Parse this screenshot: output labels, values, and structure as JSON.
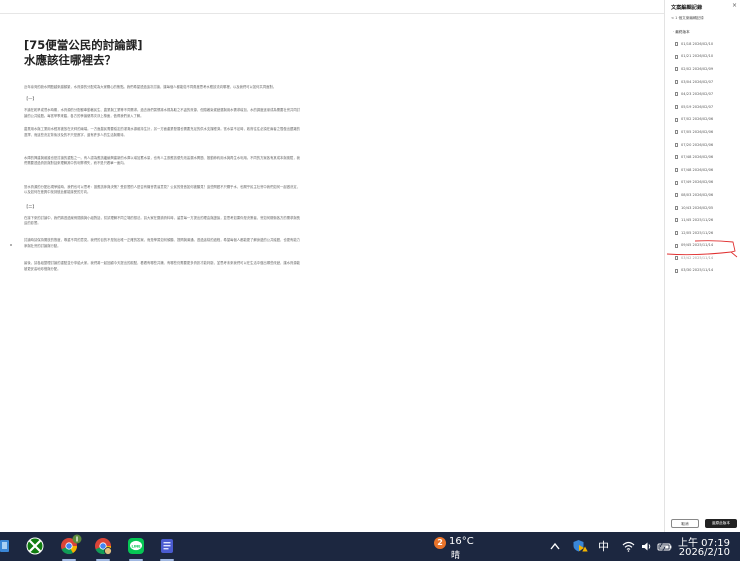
{
  "document": {
    "title_line1": "[75便當公民的討論課]",
    "title_line2": "水應該往哪裡去？",
    "paragraphs": [
      "近年臺灣的缺水問題越來越頻繁，水資源的分配成為大家關心的焦點。我們希望透過這次討論，讓每個人都能從不同角度思考水應該流向哪裡，以及我們可以如何共同面對。",
      "【一】",
      "不論在乾旱或豐水時期，水資源的分配都牽動著民生、農業與工業等不同需求。過去我們習慣將水視為取之不盡的資源，但隨著氣候變遷與用水需求增加，水的調度逐漸成為需要社會共同討論的公共議題。每當旱季來臨，各方的爭論便再次浮上檯面，值得我們深入了解。",
      "農業用水與工業用水經常被放在天秤的兩端。一方面農民需要穩定的灌溉水源維持生計，另一方面產業發展也需要充足的供水支撐經濟。當水量不足時，政府往往必須在兩者之間做出艱難的選擇，而這些決定背後涉及的不只是數字，還有許多人的生活與期待。",
      "水庫的興建與維護也是討論的重點之一。有人認為應該繼續興建新的水庫以增加蓄水量，也有人主張應該優先改善漏水問題、推動節約用水與再生水利用。不同的方案各有其成本與風險，我們需要透過資訊與對話來理解其中的利弊得失，而不是只看單一面向。",
      "當水資源的分配出現爭議時，我們也可以思考：誰應該參與決策？受影響的人是否有機會表達意見？公民的聲音如何被聽見？這些問題不只關乎水，也關乎民主社會中我們如何一起做決定，以及如何在差異中找到彼此都能接受的方向。",
      "【二】",
      "在接下來的討論中，我們將透過案例閱讀與小組對話，嘗試理解不同立場的想法。請大家在閱讀資料時，留意每一方提出的理由與證據，並思考如果你是決策者，會如何權衡各方的需求與長遠的影響。",
      "討論時請保持開放的態度，尊重不同的意見。我們的目的不是找出唯一正確的答案，而是學習如何傾聽、提問與溝通。透過這樣的過程，希望每個人都能更了解身邊的公共議題，也更有能力參與社會的討論與行動。",
      "最後，請各組整理討論的重點並分享給大家。我們將一起回顧今天提出的觀點，看看有哪些共識、有哪些仍需要更多資訊才能判斷，並思考未來我們可以在生活中做出哪些改變，讓水資源能被更妥善地珍惜與分配。"
    ]
  },
  "panel": {
    "title": "文案編輯記錄",
    "close": "×",
    "back_link": "< 1 個文案編輯記錄",
    "category": "‧ 最終版本",
    "versions": [
      "01/18 2026/02/10",
      "01/21 2026/02/10",
      "02/02 2026/02/09",
      "03/04 2026/02/07",
      "04/23 2026/02/07",
      "05/19 2026/02/07",
      "07/02 2026/02/06",
      "07/05 2026/02/06",
      "07/20 2026/02/06",
      "07/48 2026/02/06",
      "07/48 2026/02/06",
      "07/49 2026/02/06",
      "08/03 2026/02/06",
      "10/43 2026/02/05",
      "11/45 2025/11/26",
      "12/05 2025/11/26",
      "09/45 2025/11/14",
      "03/42 2025/11/14",
      "03/30 2025/11/14"
    ],
    "selected_index": 17,
    "cancel_label": "取消",
    "restore_label": "還原此版本"
  },
  "taskbar": {
    "notification_count": "2",
    "temperature": "16°C",
    "condition": "晴",
    "ime": "中",
    "time": "上午 07:19",
    "date": "2026/2/10",
    "apps": [
      "xbox-icon",
      "chrome-icon",
      "chrome-profile-icon",
      "line-icon",
      "windows-security-icon",
      "window-icon"
    ]
  },
  "colors": {
    "taskbar": "#1c2740",
    "xbox": "#107c10",
    "line": "#06c755",
    "weather_badge": "#e8732a",
    "selection_mark": "#e03030"
  }
}
